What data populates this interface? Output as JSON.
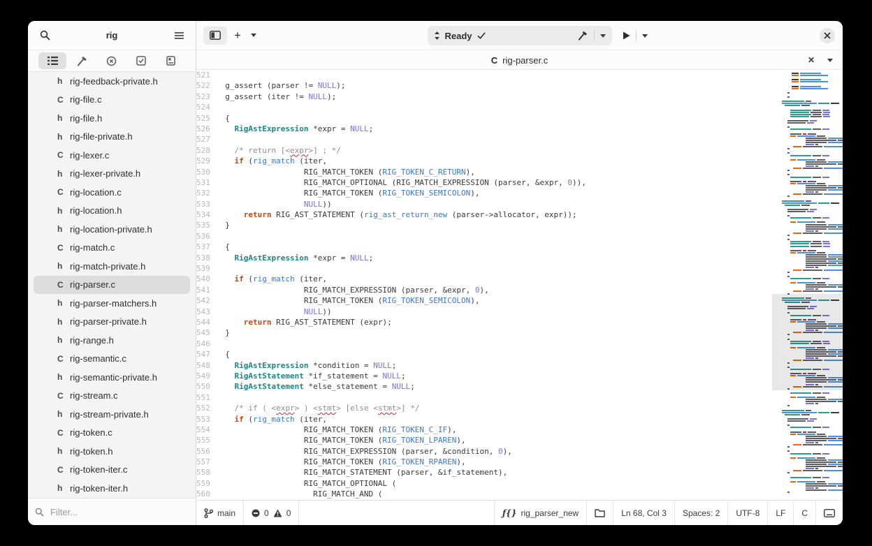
{
  "sidebar": {
    "title": "rig",
    "panel_icons": [
      "project-tree-icon",
      "build-icon",
      "diagnostics-icon",
      "tests-icon",
      "documentation-icon"
    ],
    "filter_placeholder": "Filter...",
    "files": [
      {
        "icon": "h",
        "name": "rig-feedback-private.h",
        "selected": false
      },
      {
        "icon": "C",
        "name": "rig-file.c",
        "selected": false
      },
      {
        "icon": "h",
        "name": "rig-file.h",
        "selected": false
      },
      {
        "icon": "h",
        "name": "rig-file-private.h",
        "selected": false
      },
      {
        "icon": "C",
        "name": "rig-lexer.c",
        "selected": false
      },
      {
        "icon": "h",
        "name": "rig-lexer-private.h",
        "selected": false
      },
      {
        "icon": "C",
        "name": "rig-location.c",
        "selected": false
      },
      {
        "icon": "h",
        "name": "rig-location.h",
        "selected": false
      },
      {
        "icon": "h",
        "name": "rig-location-private.h",
        "selected": false
      },
      {
        "icon": "C",
        "name": "rig-match.c",
        "selected": false
      },
      {
        "icon": "h",
        "name": "rig-match-private.h",
        "selected": false
      },
      {
        "icon": "C",
        "name": "rig-parser.c",
        "selected": true
      },
      {
        "icon": "h",
        "name": "rig-parser-matchers.h",
        "selected": false
      },
      {
        "icon": "h",
        "name": "rig-parser-private.h",
        "selected": false
      },
      {
        "icon": "h",
        "name": "rig-range.h",
        "selected": false
      },
      {
        "icon": "C",
        "name": "rig-semantic.c",
        "selected": false
      },
      {
        "icon": "h",
        "name": "rig-semantic-private.h",
        "selected": false
      },
      {
        "icon": "C",
        "name": "rig-stream.c",
        "selected": false
      },
      {
        "icon": "h",
        "name": "rig-stream-private.h",
        "selected": false
      },
      {
        "icon": "C",
        "name": "rig-token.c",
        "selected": false
      },
      {
        "icon": "h",
        "name": "rig-token.h",
        "selected": false
      },
      {
        "icon": "C",
        "name": "rig-token-iter.c",
        "selected": false
      },
      {
        "icon": "h",
        "name": "rig-token-iter.h",
        "selected": false
      }
    ]
  },
  "header": {
    "new_tab_label": "+",
    "omnibar_status": "Ready"
  },
  "tabbar": {
    "lang": "C",
    "filename": "rig-parser.c"
  },
  "editor": {
    "lines": [
      {
        "n": 521,
        "s": []
      },
      {
        "n": 522,
        "s": [
          [
            "",
            "  g_assert (parser != "
          ],
          [
            "n",
            "NULL"
          ],
          [
            "",
            ");"
          ]
        ]
      },
      {
        "n": 523,
        "s": [
          [
            "",
            "  g_assert (iter != "
          ],
          [
            "n",
            "NULL"
          ],
          [
            "",
            ");"
          ]
        ]
      },
      {
        "n": 524,
        "s": []
      },
      {
        "n": 525,
        "s": [
          [
            "",
            "  {"
          ]
        ]
      },
      {
        "n": 526,
        "s": [
          [
            "",
            "    "
          ],
          [
            "t",
            "RigAstExpression"
          ],
          [
            "",
            " *expr = "
          ],
          [
            "n",
            "NULL"
          ],
          [
            "",
            ";"
          ]
        ]
      },
      {
        "n": 527,
        "s": []
      },
      {
        "n": 528,
        "s": [
          [
            "c",
            "    /* return [<"
          ],
          [
            "u",
            "expr"
          ],
          [
            "c",
            ">] ; */"
          ]
        ]
      },
      {
        "n": 529,
        "s": [
          [
            "",
            "    "
          ],
          [
            "k",
            "if"
          ],
          [
            "",
            " ("
          ],
          [
            "b",
            "rig_match"
          ],
          [
            "",
            " (iter,"
          ]
        ]
      },
      {
        "n": 530,
        "s": [
          [
            "",
            "                   RIG_MATCH_TOKEN ("
          ],
          [
            "b",
            "RIG_TOKEN_C_RETURN"
          ],
          [
            "",
            "),"
          ]
        ]
      },
      {
        "n": 531,
        "s": [
          [
            "",
            "                   RIG_MATCH_OPTIONAL (RIG_MATCH_EXPRESSION (parser, &expr, "
          ],
          [
            "n",
            "0"
          ],
          [
            "",
            ")),"
          ]
        ]
      },
      {
        "n": 532,
        "s": [
          [
            "",
            "                   RIG_MATCH_TOKEN ("
          ],
          [
            "b",
            "RIG_TOKEN_SEMICOLON"
          ],
          [
            "",
            "),"
          ]
        ]
      },
      {
        "n": 533,
        "s": [
          [
            "",
            "                   "
          ],
          [
            "n",
            "NULL"
          ],
          [
            "",
            "))"
          ]
        ]
      },
      {
        "n": 534,
        "s": [
          [
            "",
            "      "
          ],
          [
            "k",
            "return"
          ],
          [
            "",
            " RIG_AST_STATEMENT ("
          ],
          [
            "b",
            "rig_ast_return_new"
          ],
          [
            "",
            " (parser->allocator, expr));"
          ]
        ]
      },
      {
        "n": 535,
        "s": [
          [
            "",
            "  }"
          ]
        ]
      },
      {
        "n": 536,
        "s": []
      },
      {
        "n": 537,
        "s": [
          [
            "",
            "  {"
          ]
        ]
      },
      {
        "n": 538,
        "s": [
          [
            "",
            "    "
          ],
          [
            "t",
            "RigAstExpression"
          ],
          [
            "",
            " *expr = "
          ],
          [
            "n",
            "NULL"
          ],
          [
            "",
            ";"
          ]
        ]
      },
      {
        "n": 539,
        "s": []
      },
      {
        "n": 540,
        "s": [
          [
            "",
            "    "
          ],
          [
            "k",
            "if"
          ],
          [
            "",
            " ("
          ],
          [
            "b",
            "rig_match"
          ],
          [
            "",
            " (iter,"
          ]
        ]
      },
      {
        "n": 541,
        "s": [
          [
            "",
            "                   RIG_MATCH_EXPRESSION (parser, &expr, "
          ],
          [
            "n",
            "0"
          ],
          [
            "",
            "),"
          ]
        ]
      },
      {
        "n": 542,
        "s": [
          [
            "",
            "                   RIG_MATCH_TOKEN ("
          ],
          [
            "b",
            "RIG_TOKEN_SEMICOLON"
          ],
          [
            "",
            "),"
          ]
        ]
      },
      {
        "n": 543,
        "s": [
          [
            "",
            "                   "
          ],
          [
            "n",
            "NULL"
          ],
          [
            "",
            "))"
          ]
        ]
      },
      {
        "n": 544,
        "s": [
          [
            "",
            "      "
          ],
          [
            "k",
            "return"
          ],
          [
            "",
            " RIG_AST_STATEMENT (expr);"
          ]
        ]
      },
      {
        "n": 545,
        "s": [
          [
            "",
            "  }"
          ]
        ]
      },
      {
        "n": 546,
        "s": []
      },
      {
        "n": 547,
        "s": [
          [
            "",
            "  {"
          ]
        ]
      },
      {
        "n": 548,
        "s": [
          [
            "",
            "    "
          ],
          [
            "t",
            "RigAstExpression"
          ],
          [
            "",
            " *condition = "
          ],
          [
            "n",
            "NULL"
          ],
          [
            "",
            ";"
          ]
        ]
      },
      {
        "n": 549,
        "s": [
          [
            "",
            "    "
          ],
          [
            "t",
            "RigAstStatement"
          ],
          [
            "",
            " *if_statement = "
          ],
          [
            "n",
            "NULL"
          ],
          [
            "",
            ";"
          ]
        ]
      },
      {
        "n": 550,
        "s": [
          [
            "",
            "    "
          ],
          [
            "t",
            "RigAstStatement"
          ],
          [
            "",
            " *else_statement = "
          ],
          [
            "n",
            "NULL"
          ],
          [
            "",
            ";"
          ]
        ]
      },
      {
        "n": 551,
        "s": []
      },
      {
        "n": 552,
        "s": [
          [
            "c",
            "    /* if ( <"
          ],
          [
            "u",
            "expr"
          ],
          [
            "c",
            "> ) <"
          ],
          [
            "u",
            "stmt"
          ],
          [
            "c",
            "> [else <"
          ],
          [
            "u",
            "stmt"
          ],
          [
            "c",
            ">] */"
          ]
        ]
      },
      {
        "n": 553,
        "s": [
          [
            "",
            "    "
          ],
          [
            "k",
            "if"
          ],
          [
            "",
            " ("
          ],
          [
            "b",
            "rig_match"
          ],
          [
            "",
            " (iter,"
          ]
        ]
      },
      {
        "n": 554,
        "s": [
          [
            "",
            "                   RIG_MATCH_TOKEN ("
          ],
          [
            "b",
            "RIG_TOKEN_C_IF"
          ],
          [
            "",
            "),"
          ]
        ]
      },
      {
        "n": 555,
        "s": [
          [
            "",
            "                   RIG_MATCH_TOKEN ("
          ],
          [
            "b",
            "RIG_TOKEN_LPAREN"
          ],
          [
            "",
            "),"
          ]
        ]
      },
      {
        "n": 556,
        "s": [
          [
            "",
            "                   RIG_MATCH_EXPRESSION (parser, &condition, "
          ],
          [
            "n",
            "0"
          ],
          [
            "",
            "),"
          ]
        ]
      },
      {
        "n": 557,
        "s": [
          [
            "",
            "                   RIG_MATCH_TOKEN ("
          ],
          [
            "b",
            "RIG_TOKEN_RPAREN"
          ],
          [
            "",
            "),"
          ]
        ]
      },
      {
        "n": 558,
        "s": [
          [
            "",
            "                   RIG_MATCH_STATEMENT (parser, &if_statement),"
          ]
        ]
      },
      {
        "n": 559,
        "s": [
          [
            "",
            "                   RIG_MATCH_OPTIONAL ("
          ]
        ]
      },
      {
        "n": 560,
        "s": [
          [
            "",
            "                     RIG_MATCH_AND ("
          ]
        ]
      }
    ]
  },
  "minimap": {
    "colors": {
      "g": "#5f5b64",
      "t": "#2b9c8e",
      "b": "#4a8fe0",
      "o": "#ea660f",
      "n": "#7a73da",
      "d": "#3c3842",
      "r": "#e01b24"
    },
    "motifs": {
      "b": [
        [
          0
        ]
      ],
      "ob": [
        [
          8,
          [
            3,
            "g"
          ]
        ]
      ],
      "cb": [
        [
          8,
          [
            3,
            "g"
          ]
        ],
        [
          0
        ]
      ],
      "pr": [
        [
          14,
          [
            10,
            "d"
          ],
          [
            30,
            "b"
          ]
        ],
        [
          14,
          [
            10,
            "o"
          ],
          [
            40,
            "b"
          ]
        ],
        [
          0
        ]
      ],
      "sig": [
        [
          0,
          [
            32,
            "t"
          ],
          [
            8,
            "g"
          ]
        ],
        [
          0,
          [
            50,
            "b"
          ],
          [
            16,
            "t"
          ],
          [
            12,
            "d"
          ]
        ],
        [
          4,
          [
            22,
            "t"
          ],
          [
            12,
            "g"
          ]
        ],
        [
          0
        ]
      ],
      "dcl": [
        [
          12,
          [
            30,
            "t"
          ],
          [
            12,
            "g"
          ],
          [
            10,
            "n"
          ]
        ]
      ],
      "dc2": [
        [
          12,
          [
            27,
            "t"
          ],
          [
            16,
            "g"
          ],
          [
            10,
            "n"
          ]
        ]
      ],
      "as2": [
        [
          8,
          [
            30,
            "g"
          ],
          [
            10,
            "n"
          ]
        ],
        [
          8,
          [
            26,
            "g"
          ],
          [
            10,
            "n"
          ]
        ],
        [
          0
        ]
      ],
      "cmt": [
        [
          12,
          [
            16,
            "g"
          ],
          [
            5,
            "r"
          ],
          [
            12,
            "g"
          ]
        ]
      ],
      "ifm": [
        [
          12,
          [
            8,
            "o"
          ],
          [
            26,
            "b"
          ],
          [
            12,
            "g"
          ]
        ]
      ],
      "am": [
        [
          34,
          [
            30,
            "g"
          ],
          [
            26,
            "b"
          ],
          [
            7,
            "g"
          ]
        ]
      ],
      "ag": [
        [
          34,
          [
            44,
            "g"
          ],
          [
            14,
            "g"
          ]
        ]
      ],
      "an": [
        [
          34,
          [
            12,
            "n"
          ],
          [
            4,
            "g"
          ]
        ]
      ],
      "ret": [
        [
          16,
          [
            12,
            "o"
          ],
          [
            28,
            "g"
          ],
          [
            30,
            "b"
          ],
          [
            24,
            "g"
          ]
        ]
      ]
    },
    "sequence": [
      "pr",
      "pr",
      "pr",
      "ob",
      "b",
      "cb",
      "sig",
      "dcl",
      "dc2",
      "dcl",
      "dc2",
      "b",
      "as2",
      "ob",
      "dcl",
      "b",
      "cmt",
      "ifm",
      "am",
      "ag",
      "am",
      "an",
      "ret",
      "cb",
      "ob",
      "dcl",
      "b",
      "ifm",
      "am",
      "ag",
      "an",
      "ret",
      "cb",
      "ob",
      "dcl",
      "b",
      "cmt",
      "ifm",
      "am",
      "ag",
      "am",
      "an",
      "ret",
      "cb",
      "sig",
      "as2",
      "ob",
      "dcl",
      "b",
      "ifm",
      "am",
      "ag",
      "am",
      "an",
      "ret",
      "cb",
      "ob",
      "dcl",
      "dc2",
      "dc2",
      "b",
      "cmt",
      "ifm",
      "am",
      "am",
      "ag",
      "am",
      "ag",
      "am",
      "an",
      "ret",
      "cb",
      "ob",
      "dcl",
      "b",
      "ifm",
      "am",
      "ag",
      "an",
      "ret",
      "cb",
      "sig",
      "as2",
      "ob",
      "dcl",
      "b",
      "cmt",
      "ifm",
      "am",
      "ag",
      "am",
      "an",
      "ret",
      "cb",
      "ob",
      "dcl",
      "dc2",
      "b",
      "ifm",
      "am",
      "ag",
      "am",
      "ag",
      "an",
      "ret",
      "cb",
      "ob",
      "dcl",
      "b",
      "cmt",
      "ifm",
      "am",
      "ag",
      "am",
      "an",
      "ret",
      "cb",
      "dcl",
      "b",
      "ifm",
      "am",
      "ag",
      "an",
      "cb",
      "sig",
      "as2",
      "ob",
      "dcl",
      "b",
      "cmt",
      "ifm",
      "am",
      "ag",
      "am",
      "an",
      "ret",
      "cb",
      "ob",
      "dcl",
      "b",
      "ifm",
      "am",
      "ag",
      "am",
      "ag",
      "an",
      "ret",
      "cb",
      "dcl",
      "b",
      "ifm",
      "am",
      "ag",
      "an",
      "am",
      "cb"
    ]
  },
  "statusbar": {
    "branch": "main",
    "errors": "0",
    "warnings": "0",
    "symbol": "rig_parser_new",
    "position": "Ln 68, Col 3",
    "spaces": "Spaces: 2",
    "encoding": "UTF-8",
    "line_ending": "LF",
    "language": "C"
  }
}
